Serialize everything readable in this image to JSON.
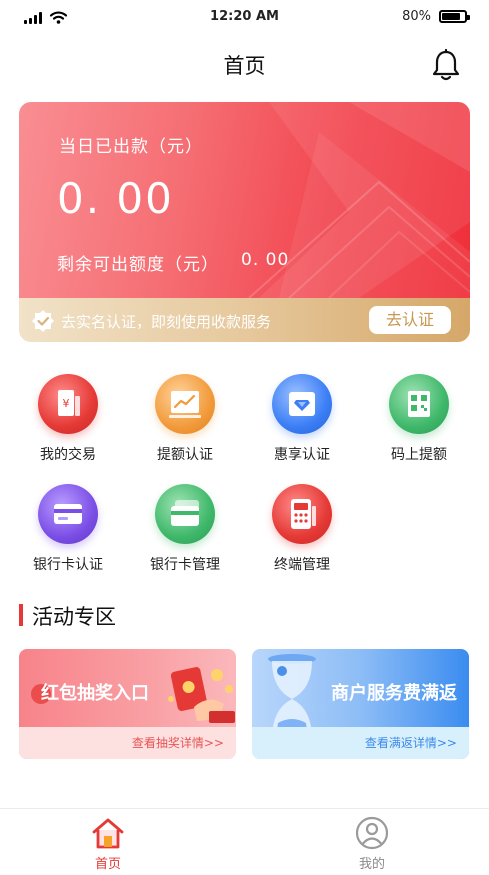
{
  "status_bar": {
    "time": "12:20 AM",
    "battery": "80%",
    "battery_level": 0.8
  },
  "nav": {
    "title": "首页",
    "bell_icon": "bell-icon"
  },
  "balance_card": {
    "today_label": "当日已出款（元）",
    "today_amount": "0. 00",
    "remaining_label": "剩余可出额度（元）",
    "remaining_amount": "0. 00",
    "verify_text": "去实名认证，即刻使用收款服务",
    "verify_button": "去认证",
    "verify_icon": "shield-check-icon"
  },
  "features": [
    {
      "label": "我的交易",
      "icon": "transaction-icon",
      "color": "#e53935"
    },
    {
      "label": "提额认证",
      "icon": "chart-icon",
      "color": "#f29b3c"
    },
    {
      "label": "惠享认证",
      "icon": "diamond-icon",
      "color": "#3b7ef5"
    },
    {
      "label": "码上提额",
      "icon": "qr-code-icon",
      "color": "#3fb86a"
    },
    {
      "label": "银行卡认证",
      "icon": "card-verify-icon",
      "color": "#7b4fe6"
    },
    {
      "label": "银行卡管理",
      "icon": "card-manage-icon",
      "color": "#3fb86a"
    },
    {
      "label": "终端管理",
      "icon": "pos-terminal-icon",
      "color": "#e53935"
    }
  ],
  "activity": {
    "title": "活动专区",
    "promos": [
      {
        "title": "红包抽奖入口",
        "link": "查看抽奖详情>>",
        "link_color": "#e85555"
      },
      {
        "title": "商户服务费满返",
        "link": "查看满返详情>>",
        "link_color": "#3c8ae8"
      }
    ]
  },
  "tabbar": {
    "tabs": [
      {
        "label": "首页",
        "icon": "home-icon",
        "active": true
      },
      {
        "label": "我的",
        "icon": "profile-icon",
        "active": false
      }
    ]
  },
  "colors": {
    "accent": "#e53935",
    "gold": "#c99751"
  }
}
